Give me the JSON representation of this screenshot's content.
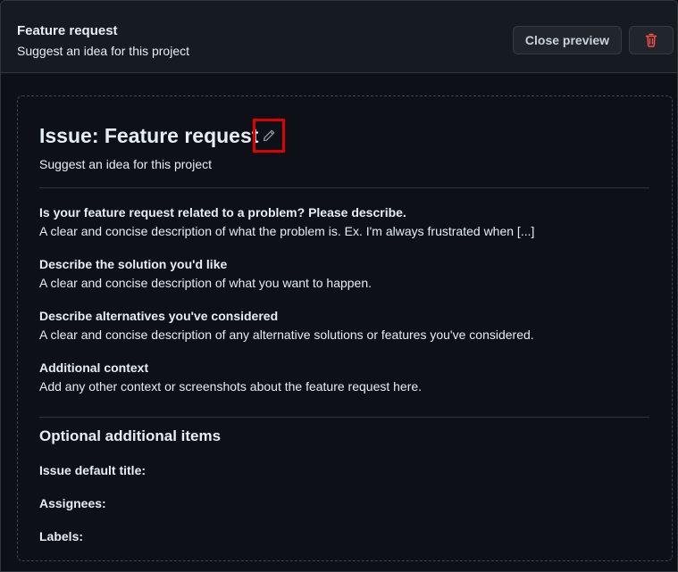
{
  "header": {
    "title": "Feature request",
    "subtitle": "Suggest an idea for this project",
    "close_preview_label": "Close preview",
    "delete_icon": "trash-icon"
  },
  "preview": {
    "title": "Issue: Feature request",
    "edit_icon": "pencil-icon",
    "description": "Suggest an idea for this project",
    "sections": [
      {
        "label": "Is your feature request related to a problem? Please describe.",
        "description": "A clear and concise description of what the problem is. Ex. I'm always frustrated when [...]"
      },
      {
        "label": "Describe the solution you'd like",
        "description": "A clear and concise description of what you want to happen."
      },
      {
        "label": "Describe alternatives you've considered",
        "description": "A clear and concise description of any alternative solutions or features you've considered."
      },
      {
        "label": "Additional context",
        "description": "Add any other context or screenshots about the feature request here."
      }
    ],
    "optional": {
      "heading": "Optional additional items",
      "default_title_label": "Issue default title:",
      "assignees_label": "Assignees:",
      "labels_label": "Labels:"
    }
  },
  "colors": {
    "background": "#0d1117",
    "header_background": "#161b22",
    "danger": "#f85149",
    "highlight": "#e00000"
  }
}
